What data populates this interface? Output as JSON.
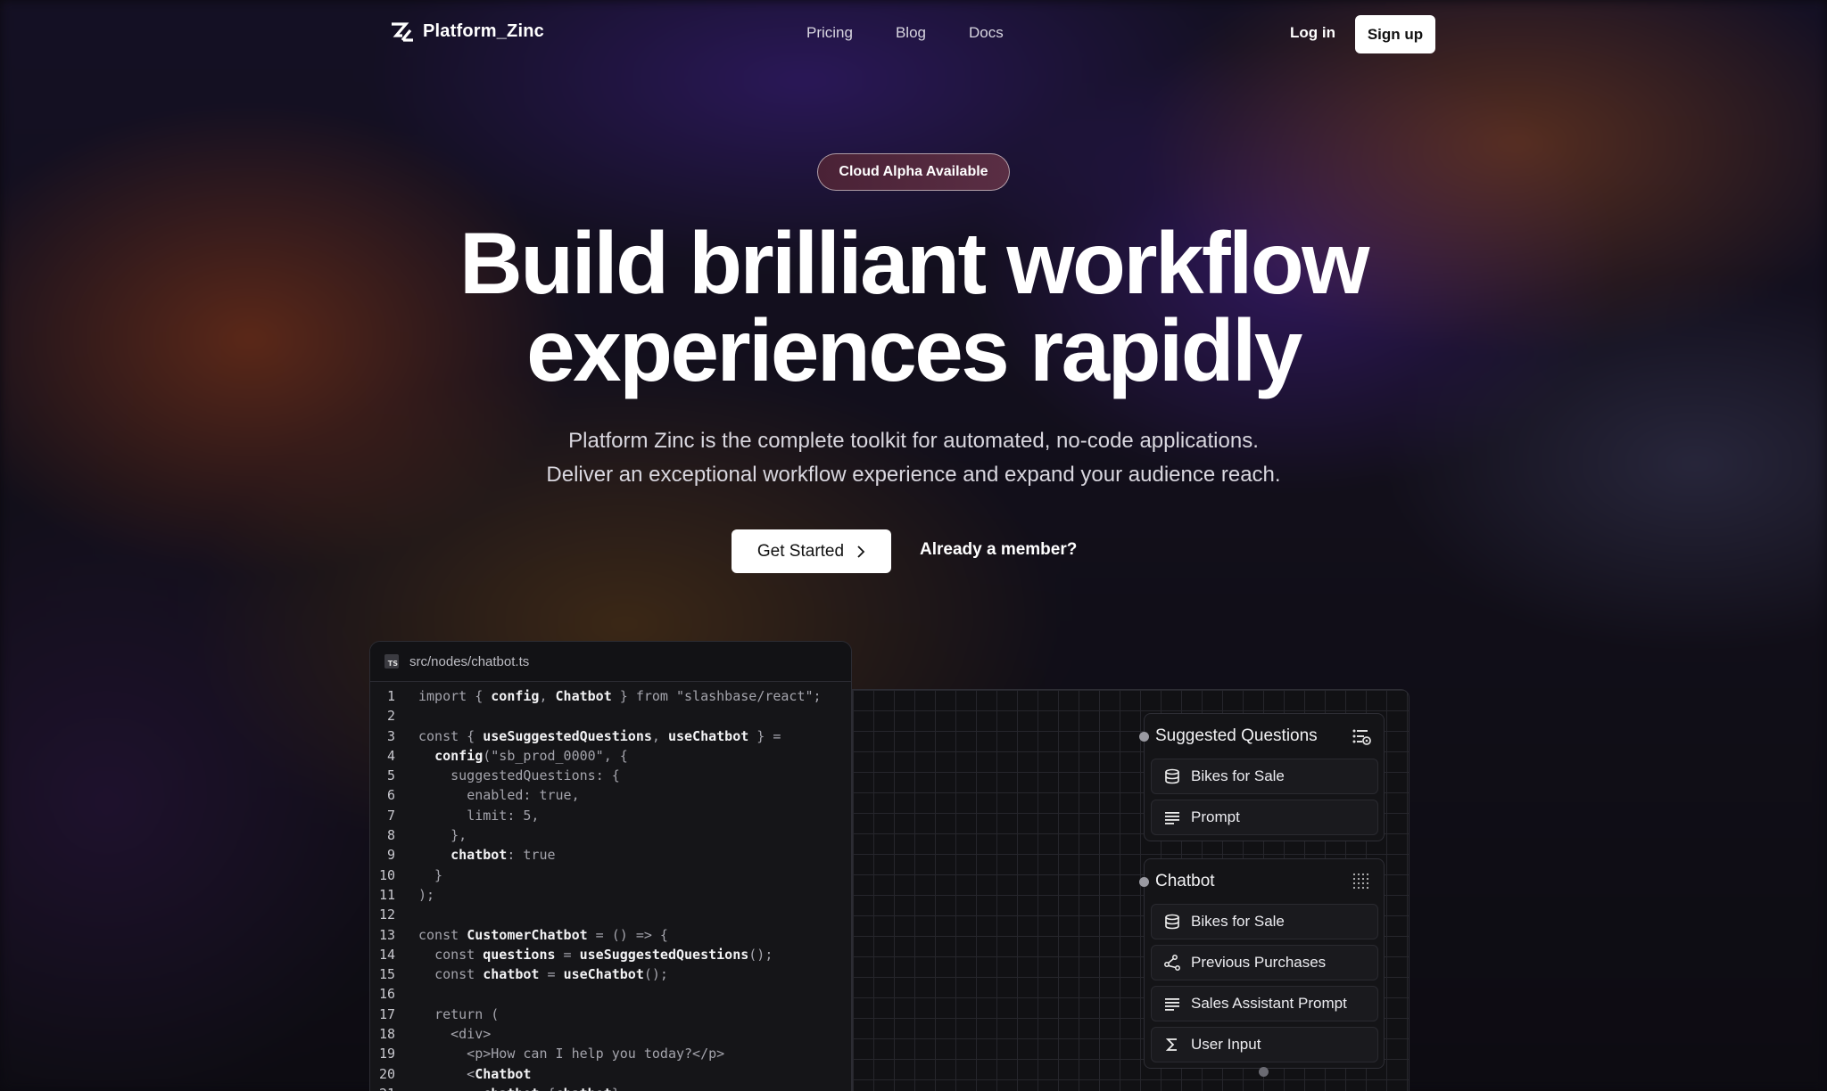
{
  "nav": {
    "brand": "Platform_Zinc",
    "links": [
      "Pricing",
      "Blog",
      "Docs"
    ],
    "login": "Log in",
    "signup": "Sign up"
  },
  "hero": {
    "badge": "Cloud Alpha Available",
    "headline_line1": "Build brilliant workflow",
    "headline_line2": "experiences rapidly",
    "subtext_line1": "Platform Zinc is the complete toolkit for automated, no-code applications.",
    "subtext_line2": "Deliver an exceptional workflow experience and expand your audience reach.",
    "cta_primary": "Get Started",
    "cta_secondary": "Already a member?"
  },
  "code": {
    "file": "src/nodes/chatbot.ts",
    "file_badge": "TS",
    "lines": [
      "import { config, Chatbot } from \"slashbase/react\";",
      "",
      "const { useSuggestedQuestions, useChatbot } =",
      "  config(\"sb_prod_0000\", {",
      "    suggestedQuestions: {",
      "      enabled: true,",
      "      limit: 5,",
      "    },",
      "    chatbot: true",
      "  }",
      ");",
      "",
      "const CustomerChatbot = () => {",
      "  const questions = useSuggestedQuestions();",
      "  const chatbot = useChatbot();",
      "",
      "  return (",
      "    <div>",
      "      <p>How can I help you today?</p>",
      "      <Chatbot",
      "        chatbot={chatbot}"
    ]
  },
  "flow": {
    "nodes": [
      {
        "title": "Suggested Questions",
        "icon": "list-settings-icon",
        "items": [
          {
            "label": "Bikes for Sale",
            "icon": "database-icon"
          },
          {
            "label": "Prompt",
            "icon": "text-lines-icon"
          }
        ]
      },
      {
        "title": "Chatbot",
        "icon": "dot-grid-icon",
        "items": [
          {
            "label": "Bikes for Sale",
            "icon": "database-icon"
          },
          {
            "label": "Previous Purchases",
            "icon": "share-nodes-icon"
          },
          {
            "label": "Sales Assistant Prompt",
            "icon": "text-lines-icon"
          },
          {
            "label": "User Input",
            "icon": "sigma-icon"
          }
        ]
      }
    ]
  },
  "colors": {
    "background": "#0b0a10",
    "badge": "#4a2236",
    "panel": "#151518"
  }
}
